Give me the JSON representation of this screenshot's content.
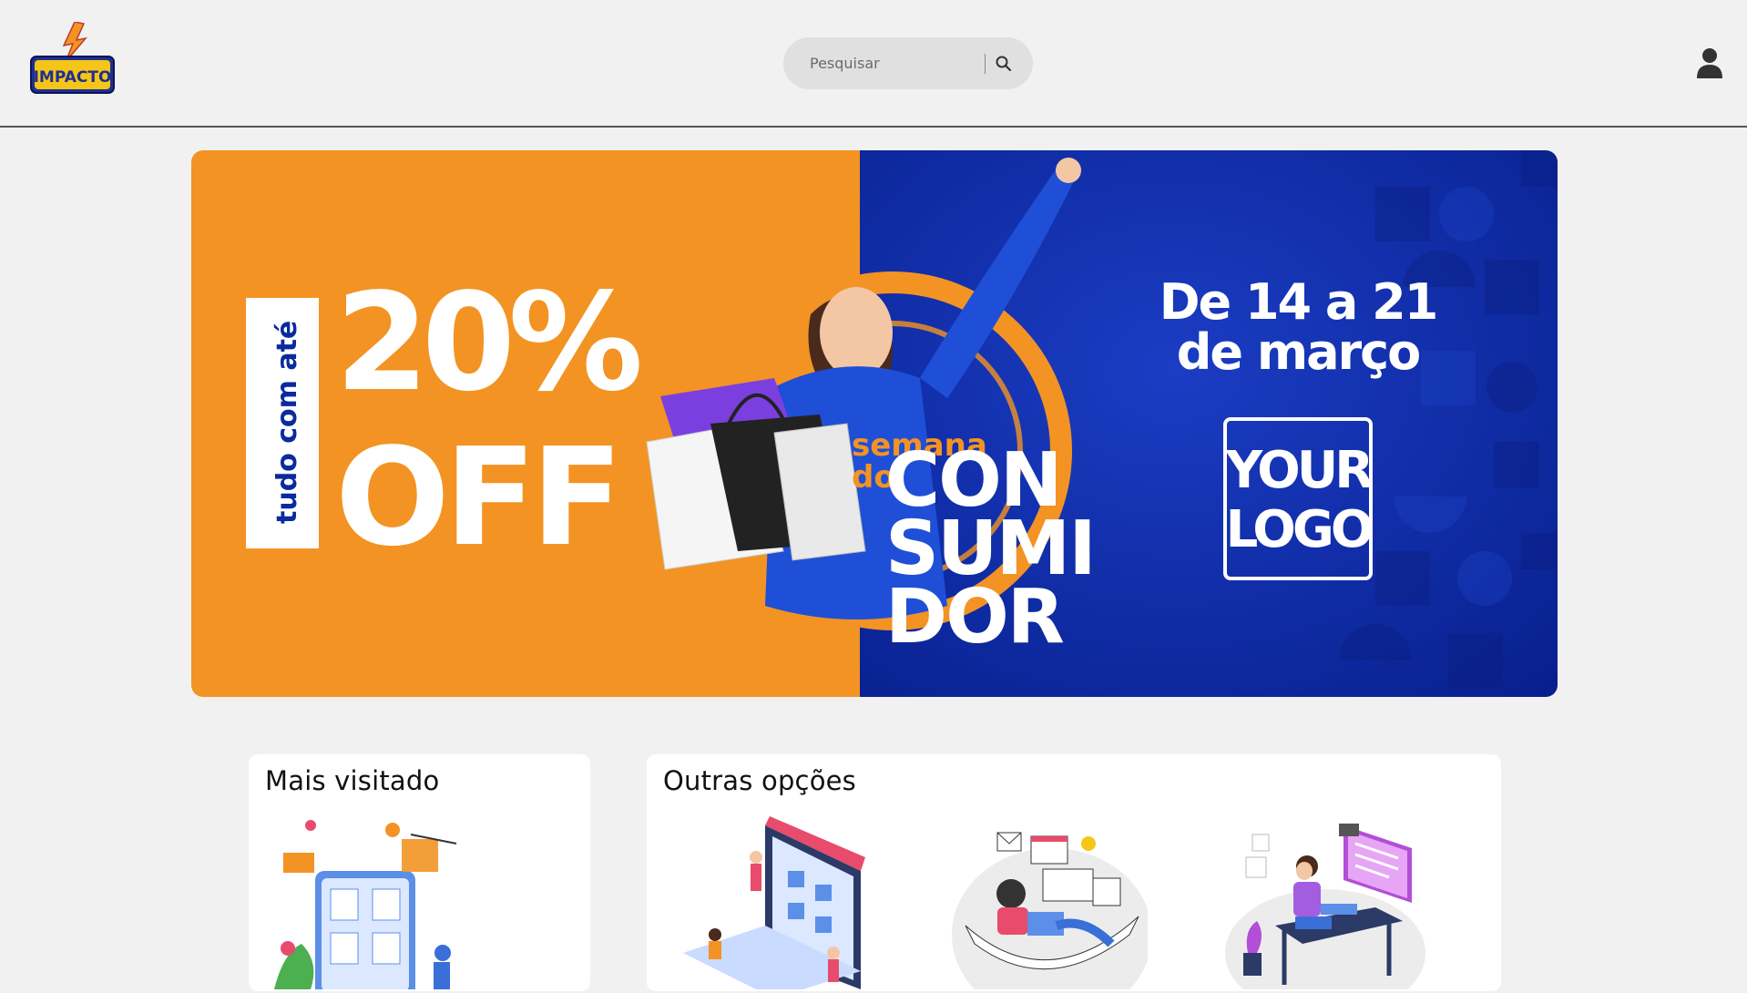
{
  "header": {
    "logo_text": "IMPACTO",
    "search_placeholder": "Pesquisar",
    "search_icon": "search-icon",
    "user_icon": "user-icon"
  },
  "banner": {
    "vertical_text": "tudo com até",
    "discount": "20%",
    "off": "OFF",
    "semana": "semana",
    "do": "do",
    "con": "CON",
    "sumi": "SUMI",
    "dor": "DOR",
    "dates_line1": "De 14 a 21",
    "dates_line2": "de março",
    "logo_line1": "YOUR",
    "logo_line2": "LOGO",
    "colors": {
      "orange": "#F39323",
      "blue": "#0a2a9e"
    }
  },
  "sections": {
    "most_visited": {
      "title": "Mais visitado"
    },
    "other_options": {
      "title": "Outras opções"
    }
  }
}
